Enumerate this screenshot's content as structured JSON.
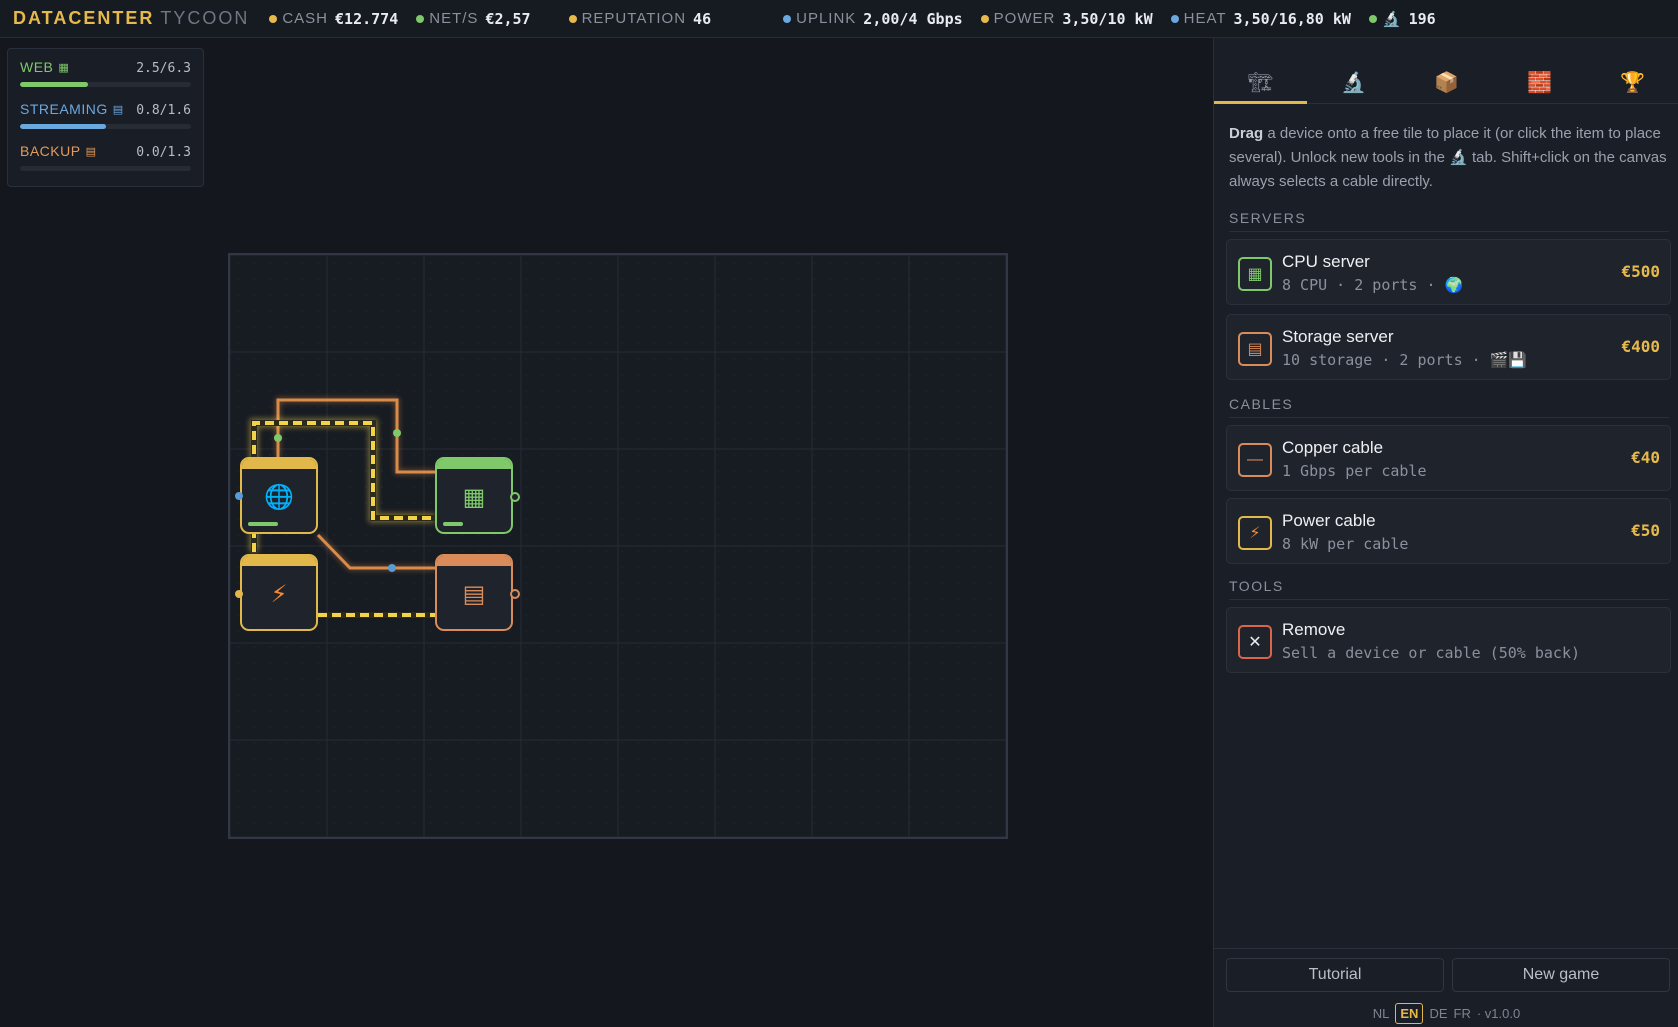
{
  "topbar": {
    "brand_primary": "DATACENTER",
    "brand_secondary": "TYCOON",
    "stats": [
      {
        "label": "CASH",
        "value": "€12.774",
        "color": "#e6b94a"
      },
      {
        "label": "NET/S",
        "value": "€2,57",
        "color": "#7fc96a"
      },
      {
        "label": "REPUTATION",
        "value": "46",
        "color": "#e6b94a"
      },
      {
        "label": "UPLINK",
        "value": "2,00/4 Gbps",
        "color": "#6aa8e0"
      },
      {
        "label": "POWER",
        "value": "3,50/10 kW",
        "color": "#e6b94a"
      },
      {
        "label": "HEAT",
        "value": "3,50/16,80 kW",
        "color": "#6aa8e0"
      },
      {
        "label": "🔬",
        "value": "196",
        "color": "#7fc96a"
      }
    ]
  },
  "demand": [
    {
      "label": "WEB",
      "icon": "cpu-icon",
      "value": "2.5/6.3",
      "fill": 0.4,
      "color": "#7fc96a"
    },
    {
      "label": "STREAMING",
      "icon": "storage-icon",
      "value": "0.8/1.6",
      "fill": 0.5,
      "color": "#6aa8e0"
    },
    {
      "label": "BACKUP",
      "icon": "storage-icon",
      "value": "0.0/1.3",
      "fill": 0.0,
      "color": "#e39a5a"
    }
  ],
  "board": {
    "devices": [
      {
        "type": "internet-uplink",
        "glyph": "🌐",
        "cap_color": "#e3b84a"
      },
      {
        "type": "cpu-server",
        "glyph": "▦",
        "cap_color": "#7fc96a"
      },
      {
        "type": "power-supply",
        "glyph": "⚡",
        "cap_color": "#e3b84a"
      },
      {
        "type": "storage-server",
        "glyph": "▤",
        "cap_color": "#d98c5a"
      }
    ]
  },
  "side": {
    "tabs": [
      {
        "name": "build-tab",
        "glyph": "🏗",
        "active": true
      },
      {
        "name": "research-tab",
        "glyph": "🔬",
        "active": false
      },
      {
        "name": "contracts-tab",
        "glyph": "📦",
        "active": false
      },
      {
        "name": "expand-tab",
        "glyph": "🧱",
        "active": false
      },
      {
        "name": "achievements-tab",
        "glyph": "🏆",
        "active": false
      }
    ],
    "help_bold": "Drag",
    "help_text": " a device onto a free tile to place it (or click the item to place several). Unlock new tools in the 🔬 tab. Shift+click on the canvas always selects a cable directly.",
    "sections": {
      "servers": "SERVERS",
      "cables": "CABLES",
      "tools": "TOOLS"
    },
    "items": {
      "cpu": {
        "name": "CPU server",
        "desc": "8 CPU · 2 ports · 🌍",
        "price": "€500",
        "glyph": "▦"
      },
      "storage": {
        "name": "Storage server",
        "desc": "10 storage · 2 ports · 🎬💾",
        "price": "€400",
        "glyph": "▤"
      },
      "copper": {
        "name": "Copper cable",
        "desc": "1 Gbps per cable",
        "price": "€40",
        "glyph": "—"
      },
      "power": {
        "name": "Power cable",
        "desc": "8 kW per cable",
        "price": "€50",
        "glyph": "⚡"
      },
      "remove": {
        "name": "Remove",
        "desc": "Sell a device or cable (50% back)",
        "glyph": "✕"
      }
    },
    "buttons": {
      "tutorial": "Tutorial",
      "new_game": "New game"
    },
    "languages": [
      "NL",
      "EN",
      "DE",
      "FR"
    ],
    "current_language": "EN",
    "version": "· v1.0.0"
  }
}
